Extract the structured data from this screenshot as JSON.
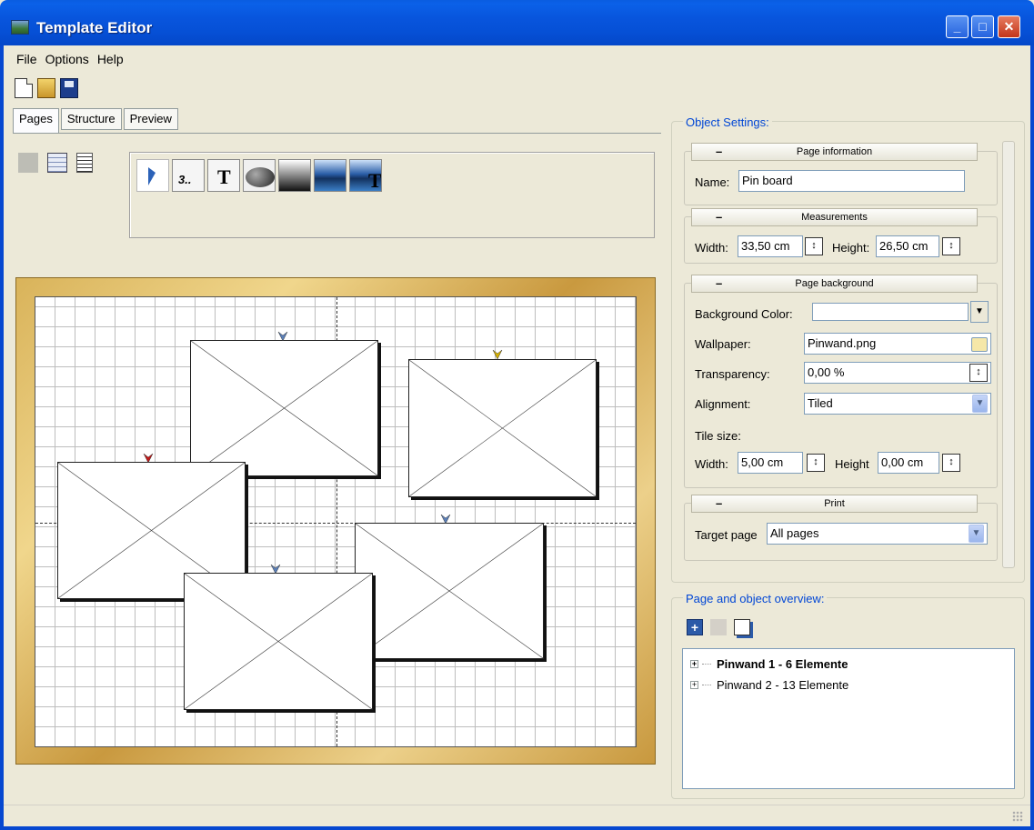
{
  "window": {
    "title": "Template Editor"
  },
  "menu": [
    "File",
    "Options",
    "Help"
  ],
  "toolbar": {
    "icons": [
      "new-file-icon",
      "open-folder-icon",
      "save-disk-icon"
    ]
  },
  "tabs": [
    {
      "label": "Pages",
      "active": true
    },
    {
      "label": "Structure",
      "active": false
    },
    {
      "label": "Preview",
      "active": false
    }
  ],
  "palette": {
    "page_number_label": "3..",
    "text_tool_label": "T",
    "text_image_label": "T"
  },
  "object_settings": {
    "title": "Object Settings:",
    "page_information": {
      "header": "Page information",
      "name_label": "Name:",
      "name_value": "Pin board"
    },
    "measurements": {
      "header": "Measurements",
      "width_label": "Width:",
      "width_value": "33,50 cm",
      "height_label": "Height:",
      "height_value": "26,50 cm"
    },
    "page_background": {
      "header": "Page background",
      "bg_color_label": "Background Color:",
      "bg_color_value": "",
      "wallpaper_label": "Wallpaper:",
      "wallpaper_value": "Pinwand.png",
      "transparency_label": "Transparency:",
      "transparency_value": "0,00 %",
      "alignment_label": "Alignment:",
      "alignment_value": "Tiled",
      "tile_size_label": "Tile size:",
      "tile_width_label": "Width:",
      "tile_width_value": "5,00 cm",
      "tile_height_label": "Height",
      "tile_height_value": "0,00 cm"
    },
    "print": {
      "header": "Print",
      "target_label": "Target page",
      "target_value": "All pages"
    }
  },
  "overview": {
    "title": "Page and object overview:",
    "items": [
      {
        "label": "Pinwand 1 - 6 Elemente",
        "bold": true
      },
      {
        "label": "Pinwand 2 - 13 Elemente",
        "bold": false
      }
    ]
  },
  "colors": {
    "titlebar": "#0650d6",
    "group_title": "#0046d5",
    "window_bg": "#ece9d8",
    "pin_colors": [
      "#5a7fb8",
      "#d4b000",
      "#c01818",
      "#5a7fb8",
      "#5a7fb8"
    ]
  }
}
